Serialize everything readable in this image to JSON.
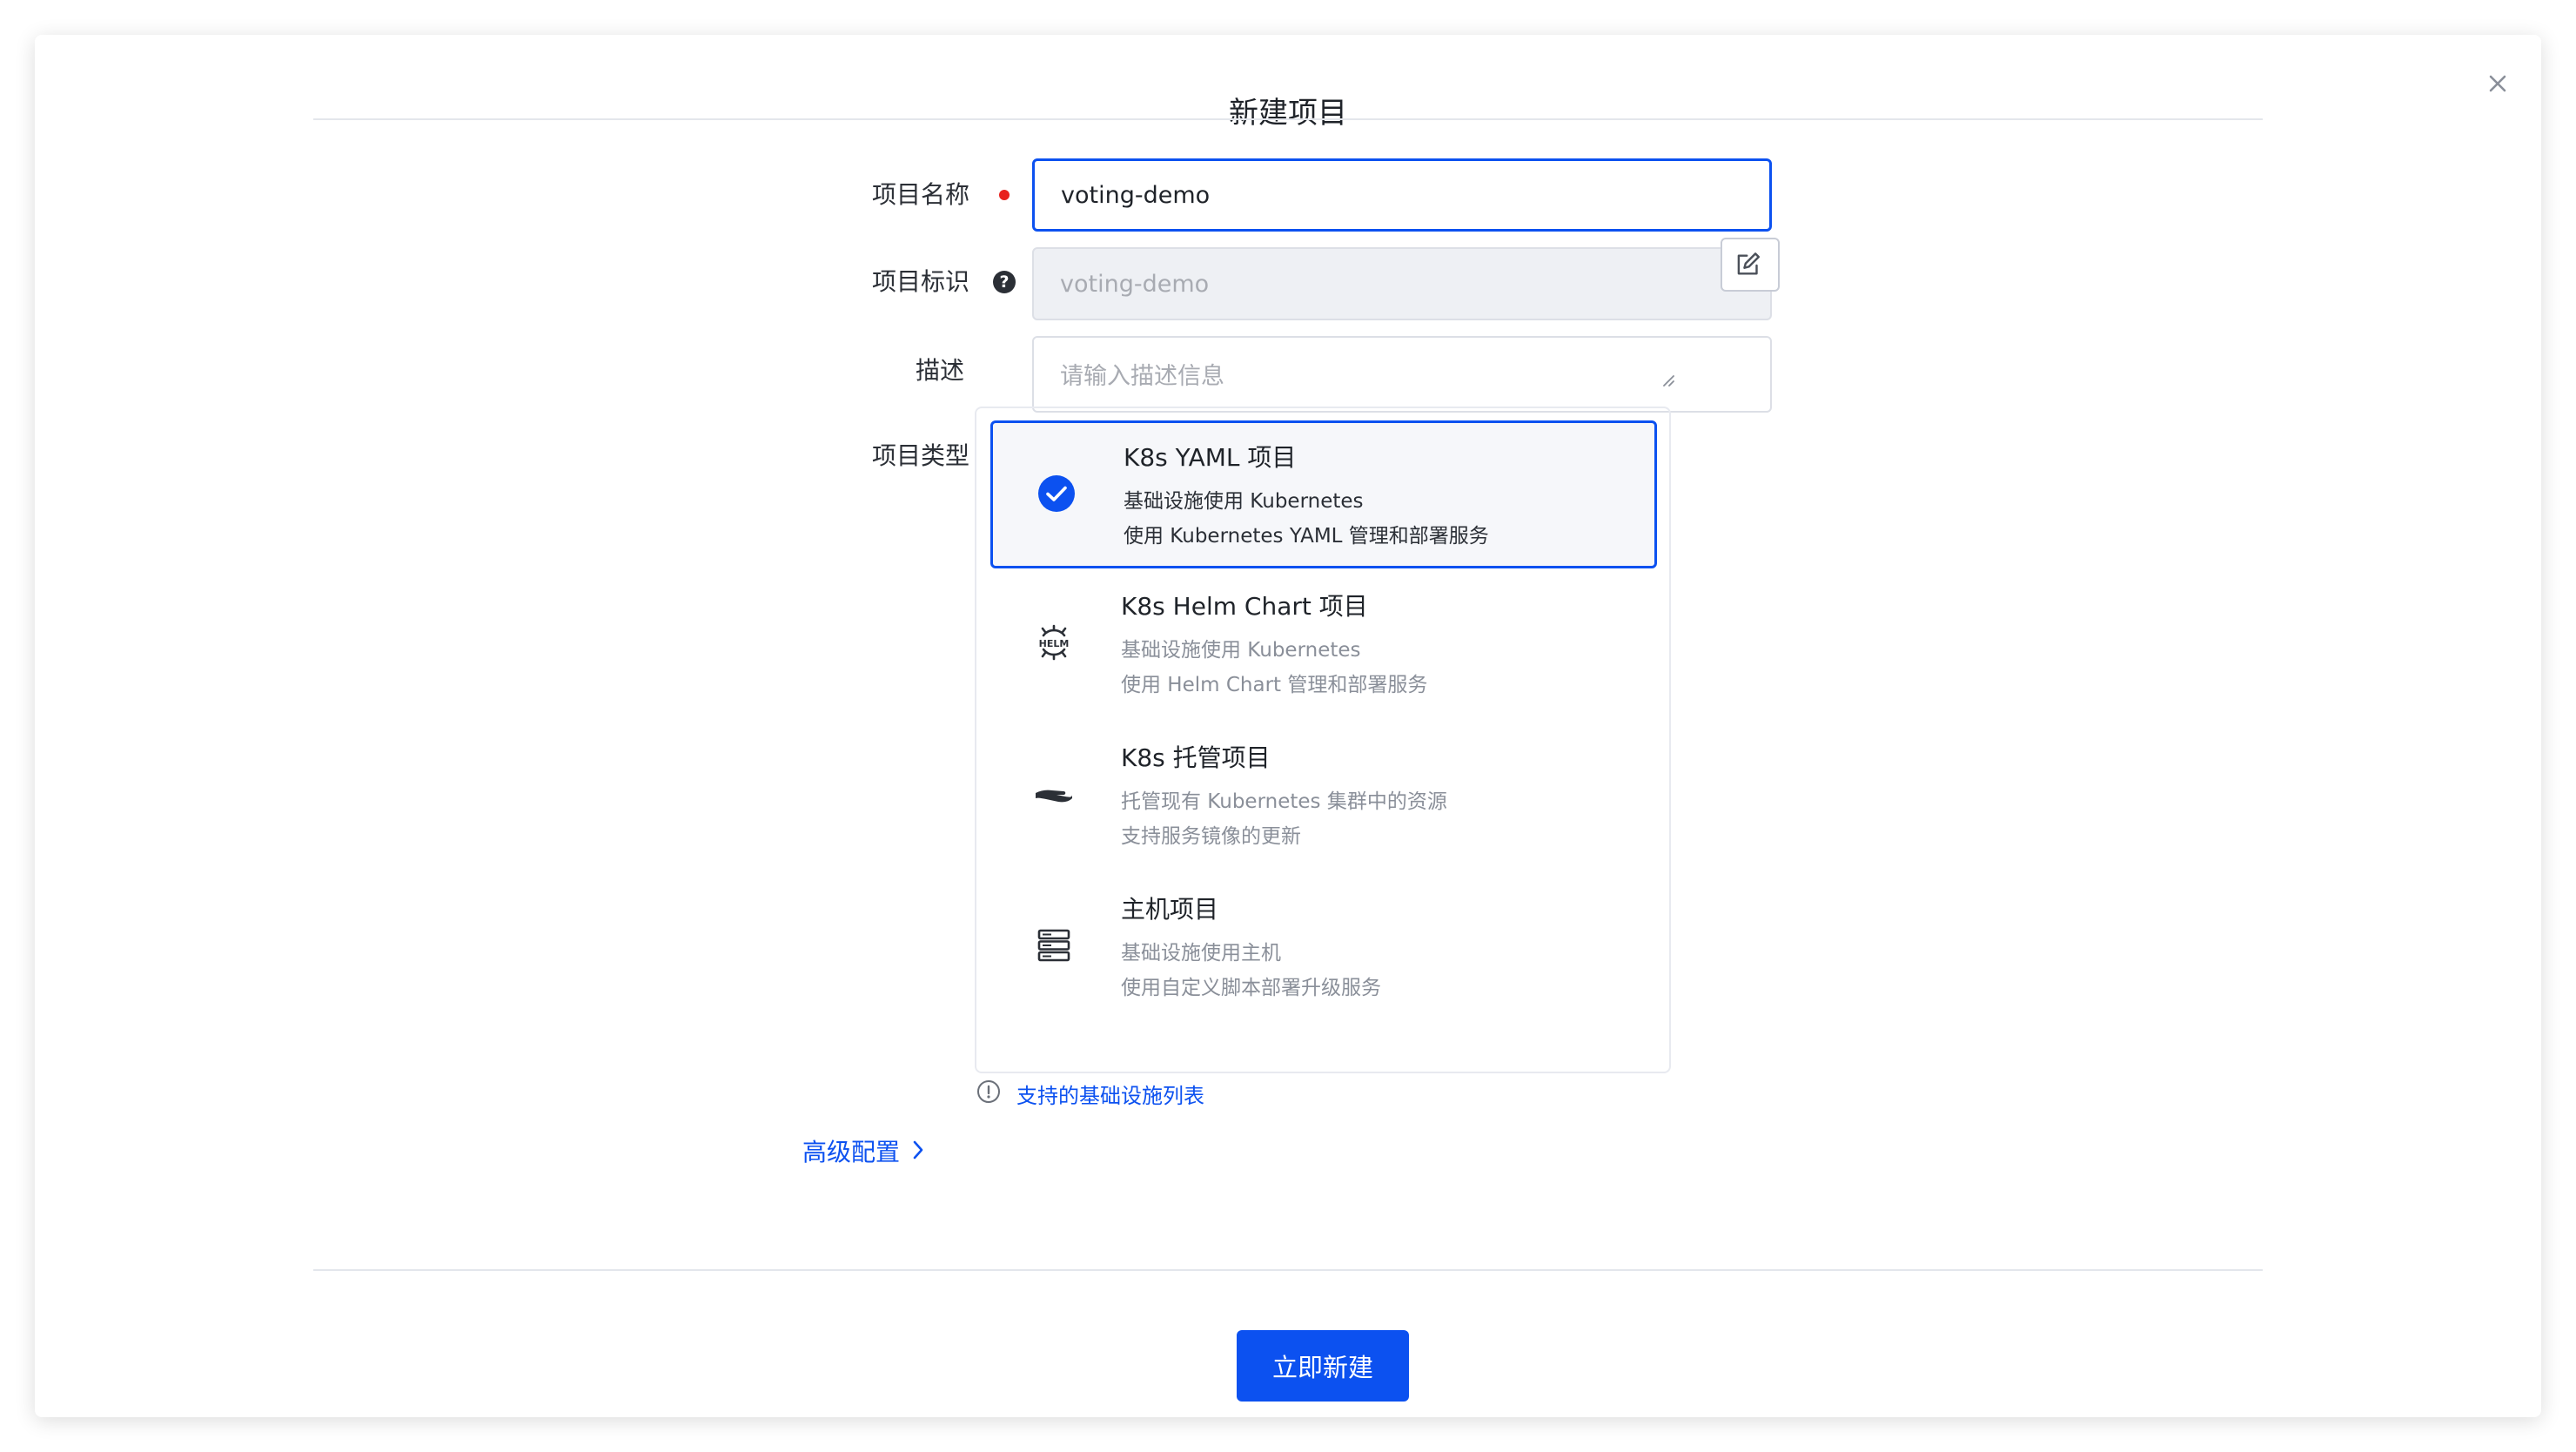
{
  "dialog": {
    "title": "新建项目",
    "submit_label": "立即新建"
  },
  "form": {
    "name_label": "项目名称",
    "name_value": "voting-demo",
    "key_label": "项目标识",
    "key_value": "voting-demo",
    "desc_label": "描述",
    "desc_placeholder": "请输入描述信息",
    "type_label": "项目类型"
  },
  "project_types": [
    {
      "icon": "check-circle-icon",
      "title": "K8s YAML 项目",
      "line1": "基础设施使用 Kubernetes",
      "line2": "使用 Kubernetes YAML 管理和部署服务",
      "selected": true
    },
    {
      "icon": "helm-icon",
      "title": "K8s Helm Chart 项目",
      "line1": "基础设施使用 Kubernetes",
      "line2": "使用 Helm Chart 管理和部署服务",
      "selected": false
    },
    {
      "icon": "hand-icon",
      "title": "K8s 托管项目",
      "line1": "托管现有 Kubernetes 集群中的资源",
      "line2": "支持服务镜像的更新",
      "selected": false
    },
    {
      "icon": "server-icon",
      "title": "主机项目",
      "line1": "基础设施使用主机",
      "line2": "使用自定义脚本部署升级服务",
      "selected": false
    }
  ],
  "infra_link": "支持的基础设施列表",
  "advanced_label": "高级配置",
  "colors": {
    "primary": "#0c51f0",
    "required": "#e8221e"
  }
}
